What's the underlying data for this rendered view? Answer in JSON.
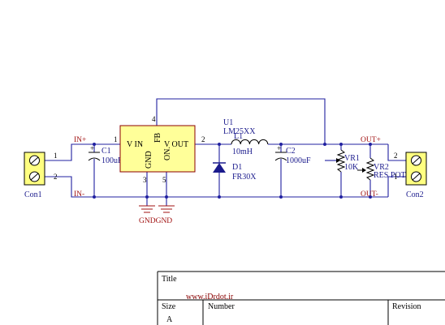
{
  "colors": {
    "wire": "#2020a0",
    "ic_body": "#ffff99",
    "net_label": "#a01010",
    "connector_body": "#ffff80",
    "frame": "#000000"
  },
  "components": {
    "con1": {
      "ref": "Con1",
      "pin1": "1",
      "pin2": "2"
    },
    "con2": {
      "ref": "Con2",
      "pin1": "2",
      "pin2": "1"
    },
    "c1": {
      "ref": "C1",
      "value": "100uF"
    },
    "u1": {
      "ref": "U1",
      "part": "LM25XX",
      "pin_vin": "V IN",
      "pin_gnd": "GND",
      "pin_fb": "FB",
      "pin_on": "ON.",
      "pin_vout": "V OUT",
      "pin1": "1",
      "pin2": "2",
      "pin3": "3",
      "pin4": "4",
      "pin5": "5"
    },
    "l1": {
      "ref": "L1",
      "value": "10mH"
    },
    "d1": {
      "ref": "D1",
      "value": "FR30X"
    },
    "c2": {
      "ref": "C2",
      "value": "1000uF"
    },
    "vr1": {
      "ref": "VR1",
      "value": "10K"
    },
    "vr2": {
      "ref": "VR2",
      "value": "RES POT"
    }
  },
  "nets": {
    "in_plus": "IN+",
    "in_minus": "IN-",
    "out_plus": "OUT+",
    "out_minus": "OUT-",
    "gnd": "GNDGND"
  },
  "title_block": {
    "title_label": "Title",
    "watermark": "www.iDrdot.ir",
    "size_label": "Size",
    "size_value": "A",
    "number_label": "Number",
    "revision_label": "Revision"
  }
}
